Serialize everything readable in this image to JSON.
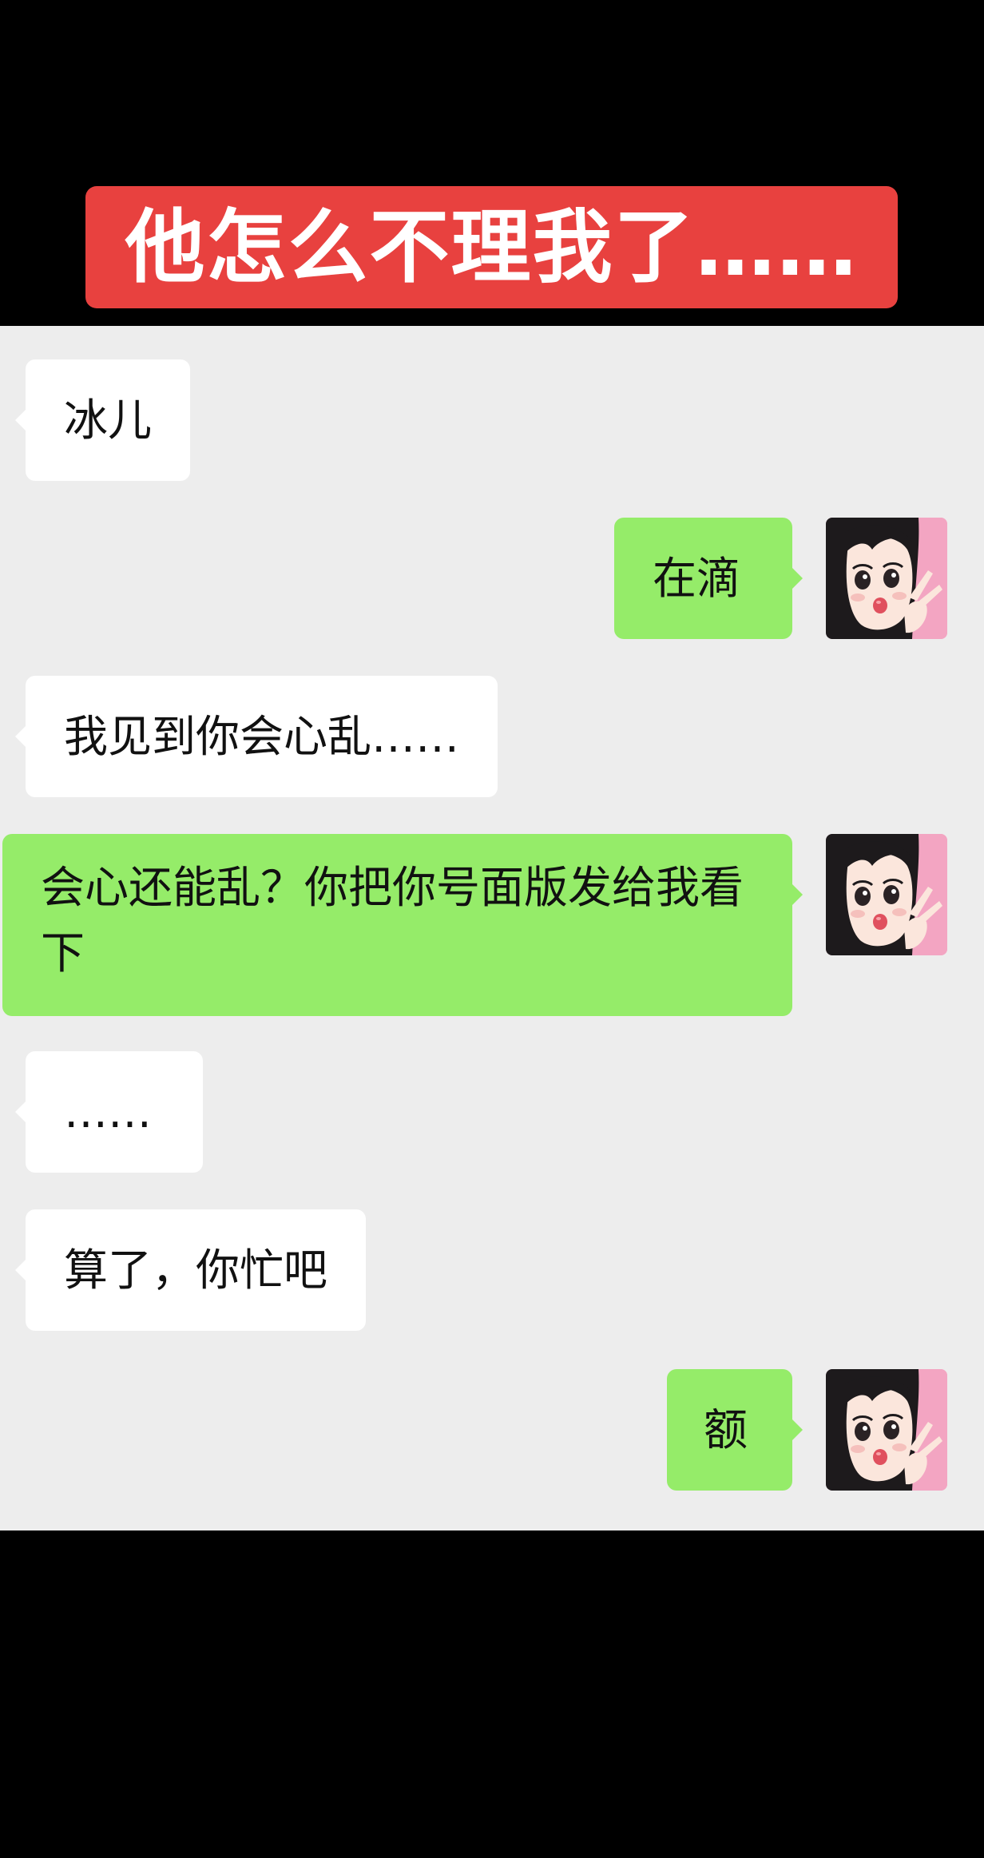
{
  "title": "他怎么不理我了……",
  "colors": {
    "banner": "#e8413f",
    "chat_background": "#ededed",
    "incoming_bubble": "#ffffff",
    "outgoing_bubble": "#95ec69",
    "page_background": "#000000"
  },
  "messages": [
    {
      "direction": "incoming",
      "text": "冰儿"
    },
    {
      "direction": "outgoing",
      "text": "在滴",
      "avatar_icon": "cartoon-girl-avatar-icon"
    },
    {
      "direction": "incoming",
      "text": "我见到你会心乱……"
    },
    {
      "direction": "outgoing",
      "text": "会心还能乱？你把你号面版发给我看下",
      "avatar_icon": "cartoon-girl-avatar-icon"
    },
    {
      "direction": "incoming",
      "text": "……"
    },
    {
      "direction": "incoming",
      "text": "算了，你忙吧"
    },
    {
      "direction": "outgoing",
      "text": "额",
      "avatar_icon": "cartoon-girl-avatar-icon"
    }
  ]
}
